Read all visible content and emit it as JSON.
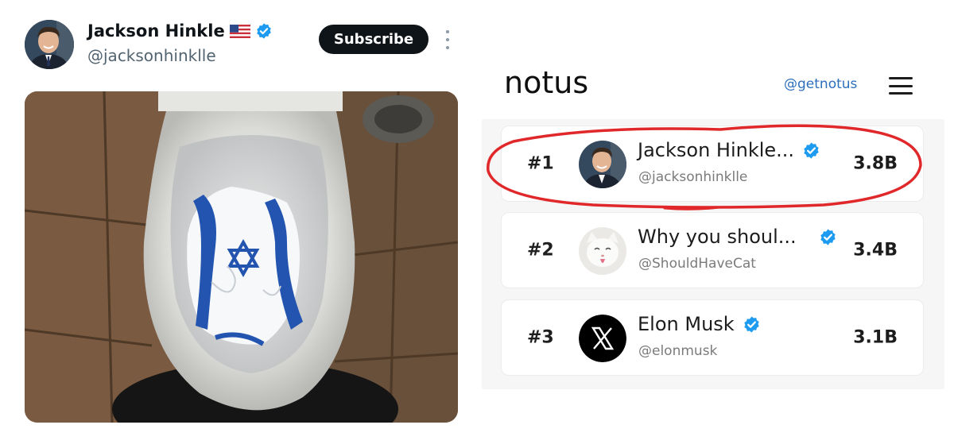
{
  "tweet": {
    "author_name": "Jackson Hinkle",
    "author_flag": "US flag",
    "author_handle": "@jacksonhinklle",
    "subscribe_label": "Subscribe",
    "verified_color": "#1d9bf0"
  },
  "notus": {
    "logo": "notus",
    "handle": "@getnotus",
    "leaderboard": [
      {
        "rank": "#1",
        "name": "Jackson Hinkle...",
        "handle": "@jacksonhinklle",
        "value": "3.8B",
        "verified": true,
        "highlighted": true,
        "highlight_color": "#e0272a"
      },
      {
        "rank": "#2",
        "name": "Why you shoul...",
        "handle": "@ShouldHaveCat",
        "value": "3.4B",
        "verified": true,
        "highlighted": false
      },
      {
        "rank": "#3",
        "name": "Elon Musk",
        "handle": "@elonmusk",
        "value": "3.1B",
        "verified": true,
        "highlighted": false
      }
    ]
  }
}
